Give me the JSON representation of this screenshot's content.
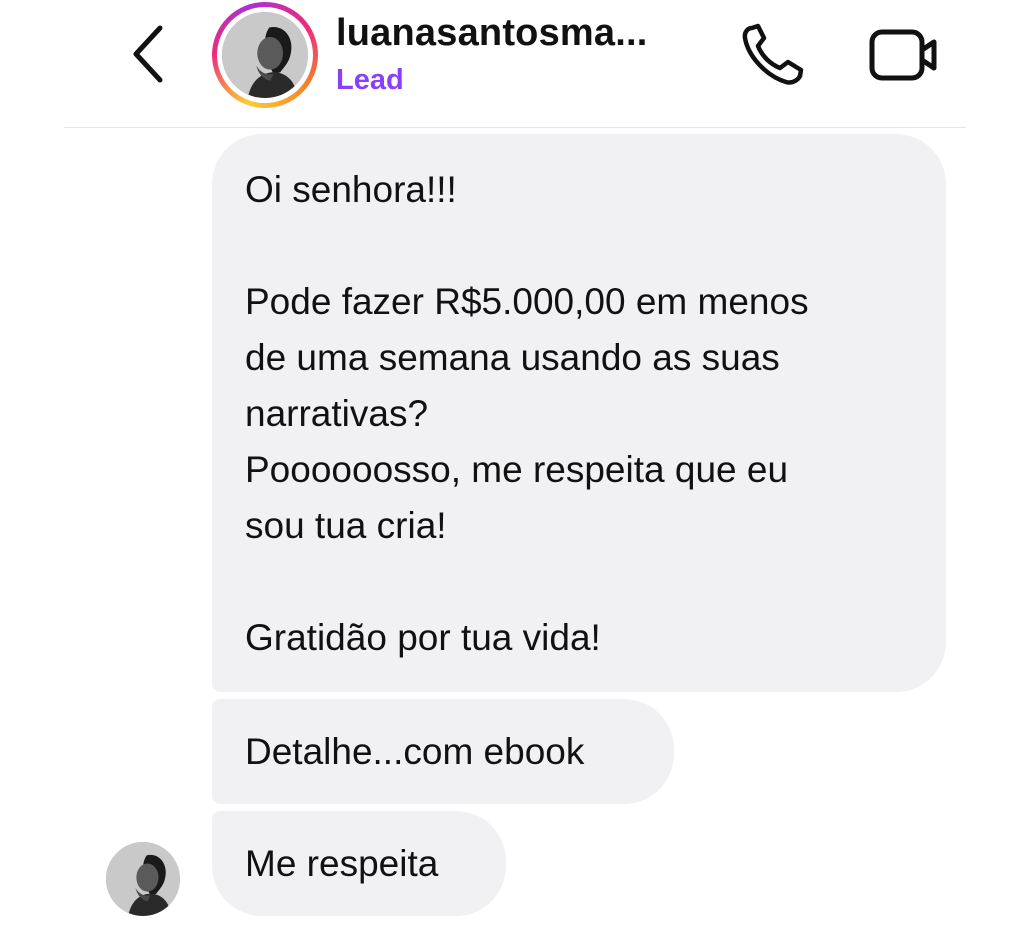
{
  "header": {
    "back_icon": "chevron-left-icon",
    "username": "luanasantosma...",
    "label": "Lead",
    "label_color": "#8a3ffc",
    "call_icon": "phone-icon",
    "video_icon": "video-camera-icon"
  },
  "messages": [
    {
      "lines": [
        "Oi senhora!!!",
        "",
        "Pode fazer R$5.000,00 em menos",
        "de uma semana usando as suas",
        "narrativas?",
        "Poooooosso, me respeita que eu",
        "sou tua cria!",
        "",
        "Gratidão por tua vida!"
      ]
    },
    {
      "text": "Detalhe...com ebook"
    },
    {
      "text": "Me respeita"
    }
  ],
  "colors": {
    "bubble_bg": "#f1f1f4",
    "accent": "#8a3ffc"
  }
}
